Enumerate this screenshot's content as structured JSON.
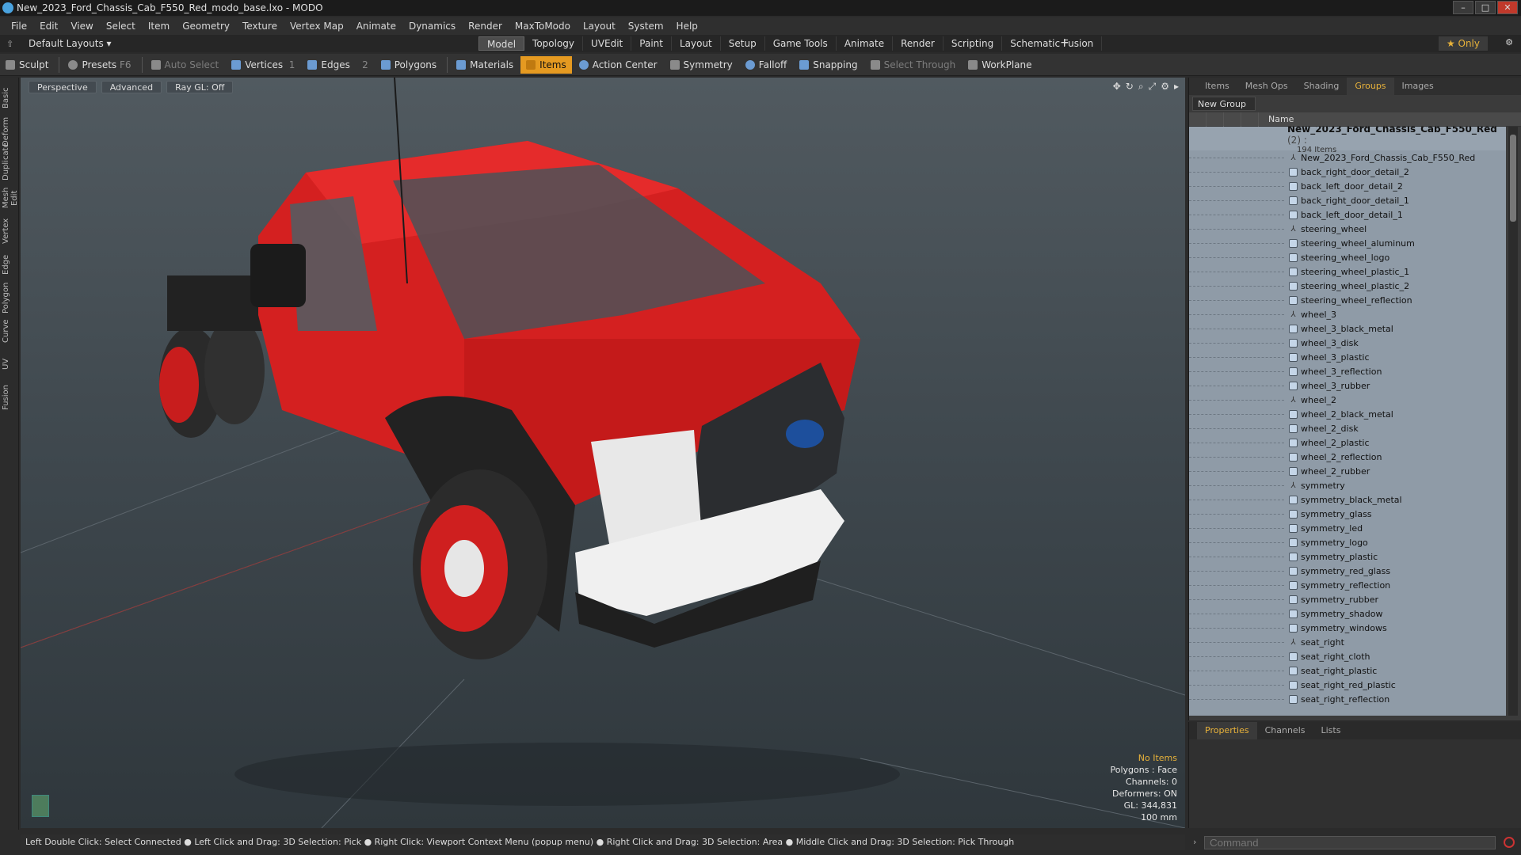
{
  "window": {
    "title": "New_2023_Ford_Chassis_Cab_F550_Red_modo_base.lxo - MODO"
  },
  "menu": [
    "File",
    "Edit",
    "View",
    "Select",
    "Item",
    "Geometry",
    "Texture",
    "Vertex Map",
    "Animate",
    "Dynamics",
    "Render",
    "MaxToModo",
    "Layout",
    "System",
    "Help"
  ],
  "layouts": {
    "default_label": "Default Layouts ▾",
    "tabs": [
      "Model",
      "Topology",
      "UVEdit",
      "Paint",
      "Layout",
      "Setup",
      "Game Tools",
      "Animate",
      "Render",
      "Scripting",
      "Schematic Fusion"
    ],
    "active_tab": "Model",
    "only_label": "★ Only"
  },
  "toolbar": {
    "sculpt": "Sculpt",
    "presets": "Presets",
    "presets_key": "F6",
    "auto_select": "Auto Select",
    "vertices": "Vertices",
    "vertices_count": "1",
    "edges": "Edges",
    "edges_count": "2",
    "polygons": "Polygons",
    "materials": "Materials",
    "items": "Items",
    "action_center": "Action Center",
    "symmetry": "Symmetry",
    "falloff": "Falloff",
    "snapping": "Snapping",
    "select_through": "Select Through",
    "workplane": "WorkPlane"
  },
  "left_tabs": [
    "Basic",
    "Deform",
    "Duplicate",
    "Mesh Edit",
    "Vertex",
    "Edge",
    "Polygon",
    "Curve",
    "UV",
    "Fusion"
  ],
  "viewport": {
    "perspective": "Perspective",
    "advanced": "Advanced",
    "raygl": "Ray GL: Off",
    "stats": {
      "no_items": "No Items",
      "polygons": "Polygons : Face",
      "channels": "Channels: 0",
      "deformers": "Deformers: ON",
      "gl": "GL: 344,831",
      "scale": "100 mm"
    }
  },
  "status": "Left Double Click: Select Connected ● Left Click and Drag: 3D Selection: Pick ● Right Click: Viewport Context Menu (popup menu) ● Right Click and Drag: 3D Selection: Area ● Middle Click and Drag: 3D Selection: Pick Through",
  "right_panel": {
    "tabs": [
      "Items",
      "Mesh Ops",
      "Shading",
      "Groups",
      "Images"
    ],
    "active_tab": "Groups",
    "new_group": "New Group",
    "name_col": "Name",
    "group_name": "New_2023_Ford_Chassis_Cab_F550_Red",
    "group_suffix": "(2) :",
    "group_count": "194 Items",
    "items": [
      {
        "t": "loc",
        "n": "New_2023_Ford_Chassis_Cab_F550_Red"
      },
      {
        "t": "mesh",
        "n": "back_right_door_detail_2"
      },
      {
        "t": "mesh",
        "n": "back_left_door_detail_2"
      },
      {
        "t": "mesh",
        "n": "back_right_door_detail_1"
      },
      {
        "t": "mesh",
        "n": "back_left_door_detail_1"
      },
      {
        "t": "loc",
        "n": "steering_wheel"
      },
      {
        "t": "mesh",
        "n": "steering_wheel_aluminum"
      },
      {
        "t": "mesh",
        "n": "steering_wheel_logo"
      },
      {
        "t": "mesh",
        "n": "steering_wheel_plastic_1"
      },
      {
        "t": "mesh",
        "n": "steering_wheel_plastic_2"
      },
      {
        "t": "mesh",
        "n": "steering_wheel_reflection"
      },
      {
        "t": "loc",
        "n": "wheel_3"
      },
      {
        "t": "mesh",
        "n": "wheel_3_black_metal"
      },
      {
        "t": "mesh",
        "n": "wheel_3_disk"
      },
      {
        "t": "mesh",
        "n": "wheel_3_plastic"
      },
      {
        "t": "mesh",
        "n": "wheel_3_reflection"
      },
      {
        "t": "mesh",
        "n": "wheel_3_rubber"
      },
      {
        "t": "loc",
        "n": "wheel_2"
      },
      {
        "t": "mesh",
        "n": "wheel_2_black_metal"
      },
      {
        "t": "mesh",
        "n": "wheel_2_disk"
      },
      {
        "t": "mesh",
        "n": "wheel_2_plastic"
      },
      {
        "t": "mesh",
        "n": "wheel_2_reflection"
      },
      {
        "t": "mesh",
        "n": "wheel_2_rubber"
      },
      {
        "t": "loc",
        "n": "symmetry"
      },
      {
        "t": "mesh",
        "n": "symmetry_black_metal"
      },
      {
        "t": "mesh",
        "n": "symmetry_glass"
      },
      {
        "t": "mesh",
        "n": "symmetry_led"
      },
      {
        "t": "mesh",
        "n": "symmetry_logo"
      },
      {
        "t": "mesh",
        "n": "symmetry_plastic"
      },
      {
        "t": "mesh",
        "n": "symmetry_red_glass"
      },
      {
        "t": "mesh",
        "n": "symmetry_reflection"
      },
      {
        "t": "mesh",
        "n": "symmetry_rubber"
      },
      {
        "t": "mesh",
        "n": "symmetry_shadow"
      },
      {
        "t": "mesh",
        "n": "symmetry_windows"
      },
      {
        "t": "loc",
        "n": "seat_right"
      },
      {
        "t": "mesh",
        "n": "seat_right_cloth"
      },
      {
        "t": "mesh",
        "n": "seat_right_plastic"
      },
      {
        "t": "mesh",
        "n": "seat_right_red_plastic"
      },
      {
        "t": "mesh",
        "n": "seat_right_reflection"
      }
    ]
  },
  "properties": {
    "tabs": [
      "Properties",
      "Channels",
      "Lists"
    ],
    "active_tab": "Properties"
  },
  "command": {
    "placeholder": "Command"
  }
}
